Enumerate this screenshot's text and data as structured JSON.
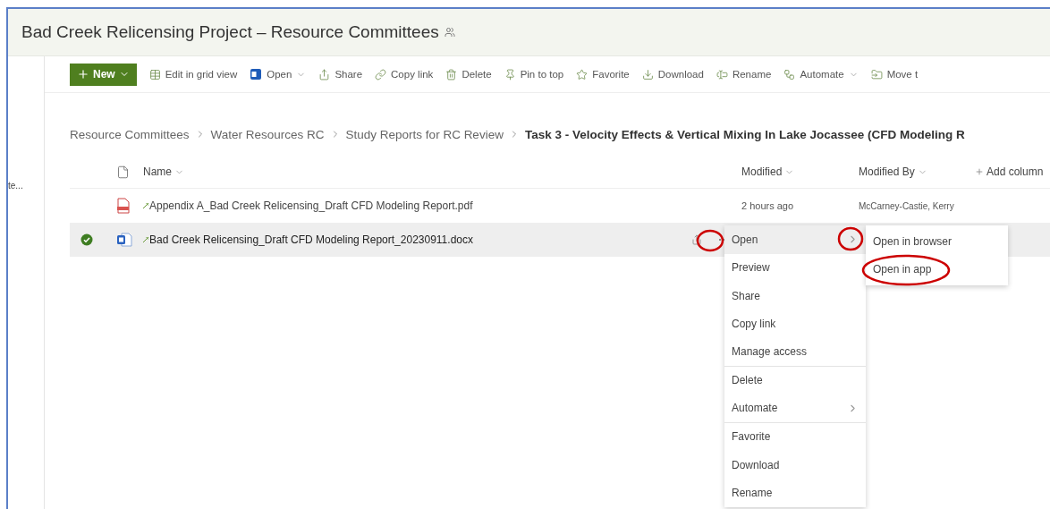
{
  "header": {
    "title": "Bad Creek Relicensing Project – Resource Committees"
  },
  "sidebar": {
    "items": [
      {
        "label": "te...",
        "selected": false
      }
    ]
  },
  "toolbar": {
    "new_button": "New",
    "actions": [
      {
        "label": "Edit in grid view",
        "kind": "grid",
        "dropdown": false
      },
      {
        "label": "Open",
        "kind": "word",
        "dropdown": true
      },
      {
        "label": "Share",
        "kind": "share",
        "dropdown": false
      },
      {
        "label": "Copy link",
        "kind": "link",
        "dropdown": false
      },
      {
        "label": "Delete",
        "kind": "delete",
        "dropdown": false
      },
      {
        "label": "Pin to top",
        "kind": "pin",
        "dropdown": false
      },
      {
        "label": "Favorite",
        "kind": "star",
        "dropdown": false
      },
      {
        "label": "Download",
        "kind": "download",
        "dropdown": false
      },
      {
        "label": "Rename",
        "kind": "rename",
        "dropdown": false
      },
      {
        "label": "Automate",
        "kind": "automate",
        "dropdown": true
      },
      {
        "label": "Move t",
        "kind": "move",
        "dropdown": false
      }
    ]
  },
  "breadcrumb": {
    "items": [
      {
        "label": "Resource Committees",
        "current": false
      },
      {
        "label": "Water Resources RC",
        "current": false
      },
      {
        "label": "Study Reports for RC Review",
        "current": false
      },
      {
        "label": "Task 3 - Velocity Effects & Vertical Mixing In Lake Jocassee (CFD Modeling R",
        "current": true
      }
    ]
  },
  "table": {
    "columns": [
      {
        "label": "Name"
      },
      {
        "label": "Modified"
      },
      {
        "label": "Modified By"
      }
    ],
    "add_column": "Add column",
    "rows": [
      {
        "name": "Appendix A_Bad Creek Relicensing_Draft CFD Modeling Report.pdf",
        "kind": "pdf",
        "modified": "2 hours ago",
        "modified_by": "McCarney-Castie, Kerry",
        "selected": false
      },
      {
        "name": "Bad Creek Relicensing_Draft CFD Modeling Report_20230911.docx",
        "kind": "docx",
        "selected": true
      }
    ]
  },
  "context_menu": {
    "items": [
      {
        "label": "Open",
        "selected": true,
        "submenu": true,
        "divider_after": false
      },
      {
        "label": "Preview",
        "selected": false,
        "submenu": false,
        "divider_after": false
      },
      {
        "label": "Share",
        "selected": false,
        "submenu": false,
        "divider_after": false
      },
      {
        "label": "Copy link",
        "selected": false,
        "submenu": false,
        "divider_after": false
      },
      {
        "label": "Manage access",
        "selected": false,
        "submenu": false,
        "divider_after": true
      },
      {
        "label": "Delete",
        "selected": false,
        "submenu": false,
        "divider_after": false
      },
      {
        "label": "Automate",
        "selected": false,
        "submenu": true,
        "divider_after": true
      },
      {
        "label": "Favorite",
        "selected": false,
        "submenu": false,
        "divider_after": false
      },
      {
        "label": "Download",
        "selected": false,
        "submenu": false,
        "divider_after": false
      },
      {
        "label": "Rename",
        "selected": false,
        "submenu": false,
        "divider_after": false
      }
    ]
  },
  "submenu": {
    "items": [
      {
        "label": "Open in browser"
      },
      {
        "label": "Open in app"
      }
    ]
  }
}
